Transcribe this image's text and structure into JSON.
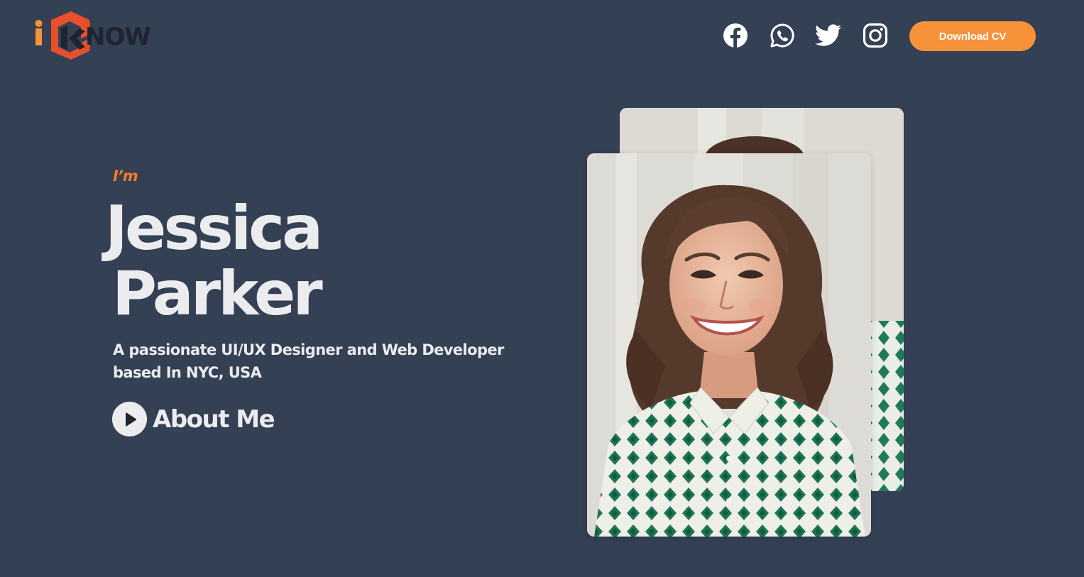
{
  "header": {
    "logo_alt": "iKNOW",
    "social": [
      "facebook-icon",
      "whatsapp-icon",
      "twitter-icon",
      "instagram-icon"
    ],
    "download_cv_label": "Download CV"
  },
  "hero": {
    "intro": "I’m",
    "first_name": "Jessica",
    "last_name": "Parker",
    "tagline_line1": "A passionate UI/UX Designer and Web Developer",
    "tagline_line2": "based In NYC, USA",
    "about_label": "About Me"
  },
  "colors": {
    "background": "#344054",
    "accent": "#f7923a",
    "intro_color": "#f57b2a",
    "text": "#ececef"
  }
}
